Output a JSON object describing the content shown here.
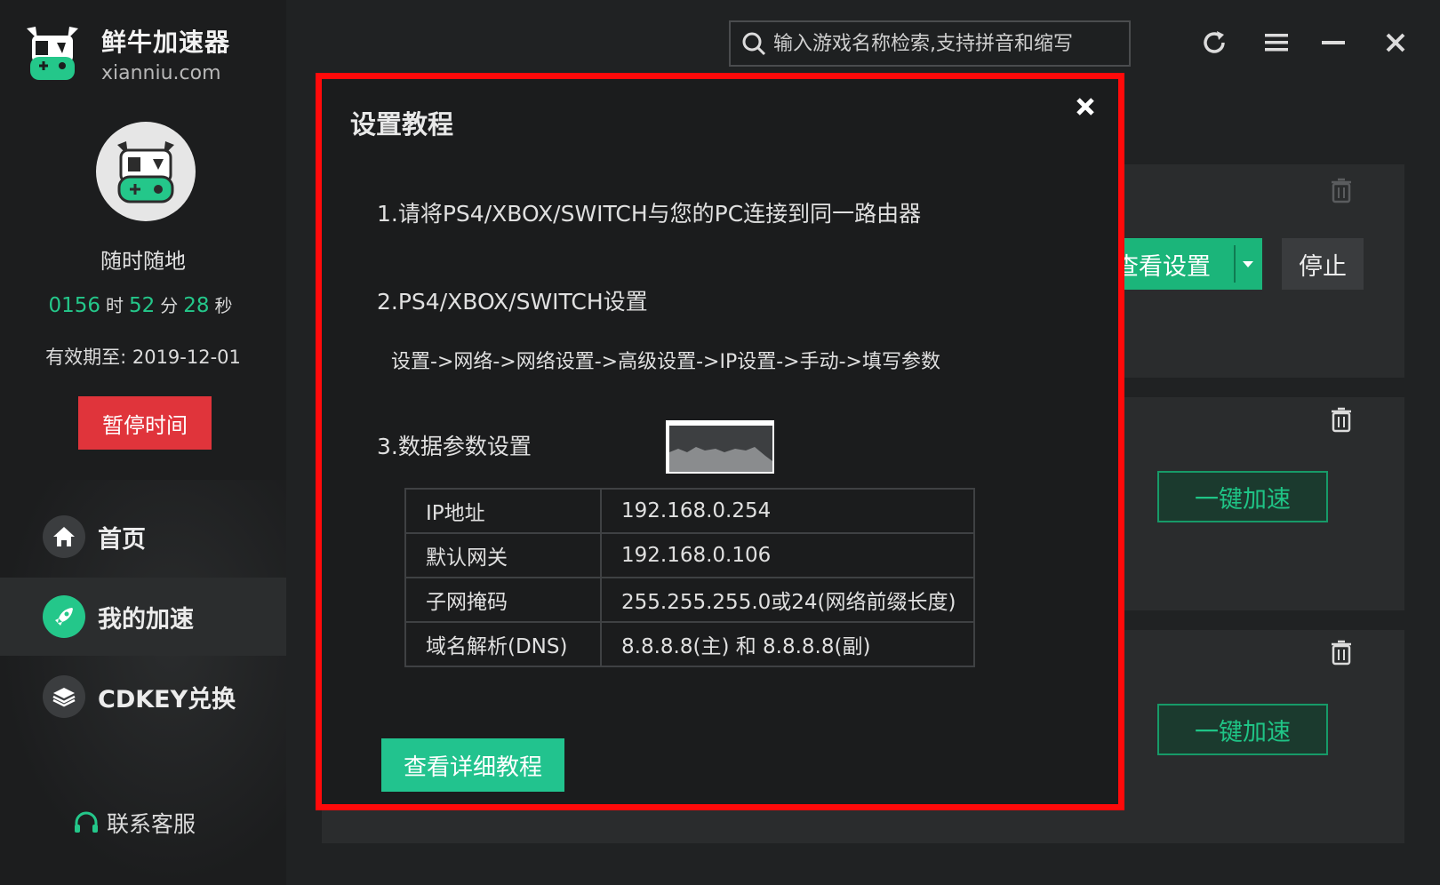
{
  "app": {
    "name": "鲜牛加速器",
    "domain": "xianniu.com"
  },
  "user": {
    "plan": "随时随地",
    "timer": {
      "hours": "0156",
      "hours_unit": "时",
      "minutes": "52",
      "minutes_unit": "分",
      "seconds": "28",
      "seconds_unit": "秒"
    },
    "expire": "有效期至: 2019-12-01",
    "pause_label": "暂停时间"
  },
  "nav": {
    "items": [
      {
        "label": "首页",
        "icon": "home-icon"
      },
      {
        "label": "我的加速",
        "icon": "rocket-icon",
        "active": true
      },
      {
        "label": "CDKEY兑换",
        "icon": "layers-icon"
      }
    ],
    "support": "联系客服"
  },
  "search": {
    "placeholder": "输入游戏名称检索,支持拼音和缩写"
  },
  "cards": {
    "view_settings": "查看设置",
    "stop": "停止",
    "accelerate_1": "一键加速",
    "accelerate_2": "一键加速"
  },
  "modal": {
    "title": "设置教程",
    "step1": "1.请将PS4/XBOX/SWITCH与您的PC连接到同一路由器",
    "step2": "2.PS4/XBOX/SWITCH设置",
    "path": "设置->网络->网络设置->高级设置->IP设置->手动->填写参数",
    "step3": "3.数据参数设置",
    "params": [
      {
        "key": "IP地址",
        "value": "192.168.0.254"
      },
      {
        "key": "默认网关",
        "value": "192.168.0.106"
      },
      {
        "key": "子网掩码",
        "value": "255.255.255.0或24(网络前缀长度)"
      },
      {
        "key": "域名解析(DNS)",
        "value": "8.8.8.8(主) 和 8.8.8.8(副)"
      }
    ],
    "detail_button": "查看详细教程"
  },
  "colors": {
    "accent": "#24c78a",
    "danger": "#e0343b",
    "highlight": "#ff0a0a",
    "background": "#202223"
  }
}
